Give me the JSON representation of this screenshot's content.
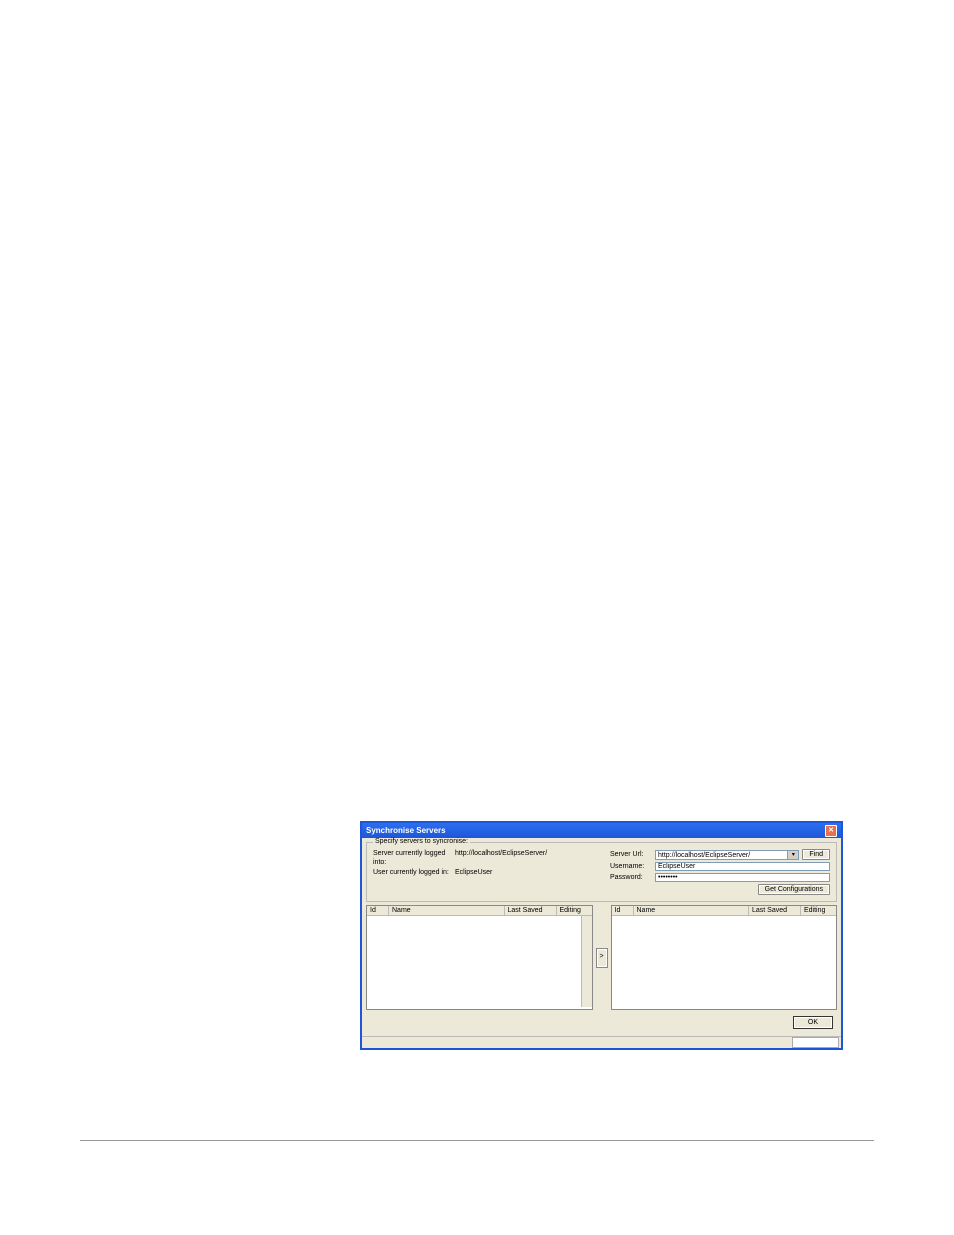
{
  "window": {
    "title": "Synchronise Servers"
  },
  "group": {
    "label": "Specify servers to syncronise:"
  },
  "info": {
    "server_label": "Server currently logged into:",
    "server_value": "http://localhost/EclipseServer/",
    "user_label": "User currently logged in:",
    "user_value": "EclipseUser"
  },
  "form": {
    "serverurl_label": "Server Url:",
    "serverurl_value": "http://localhost/EclipseServer/",
    "username_label": "Username:",
    "username_value": "EclipseUser",
    "password_label": "Password:",
    "password_value": "********",
    "find_label": "Find",
    "getconfig_label": "Get Configurations"
  },
  "columns": {
    "id": "Id",
    "name": "Name",
    "last_saved": "Last Saved",
    "editing": "Editing"
  },
  "transfer": {
    "label": ">"
  },
  "buttons": {
    "ok": "OK"
  }
}
